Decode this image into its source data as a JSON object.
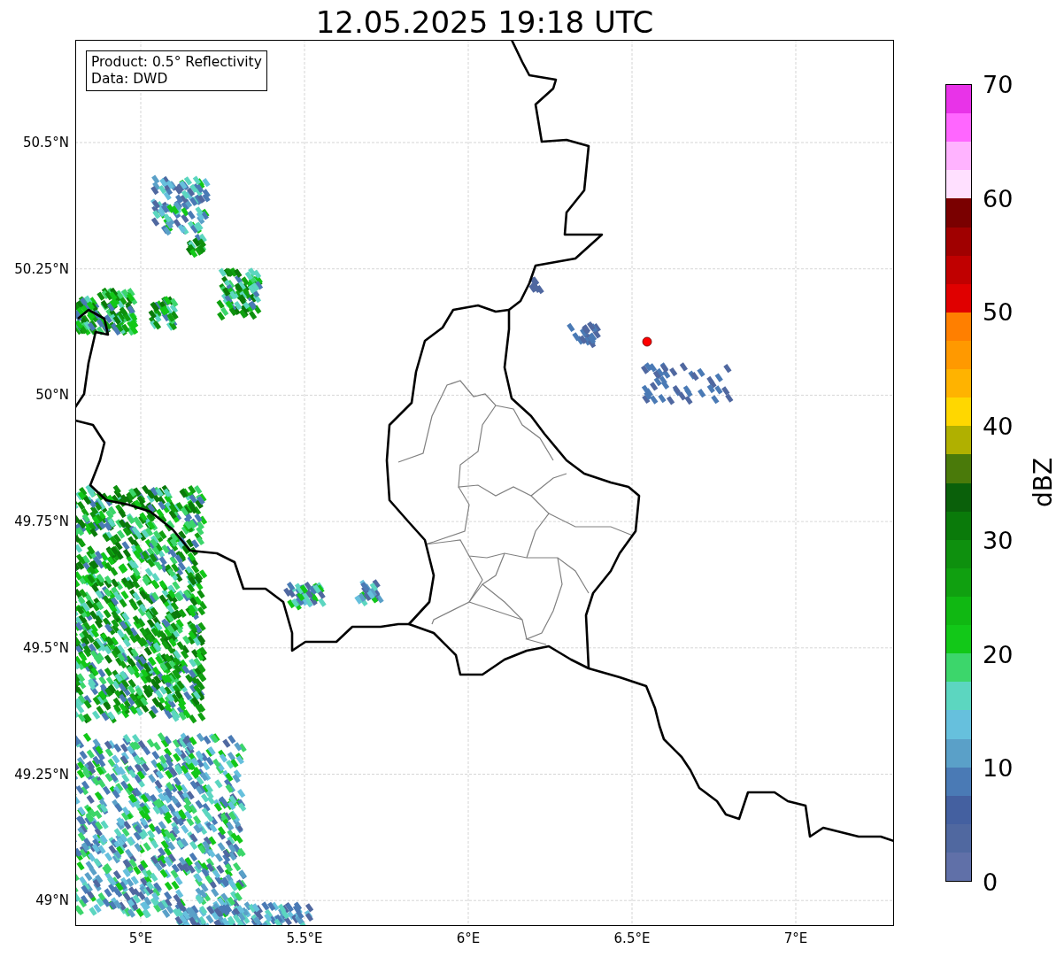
{
  "title": "12.05.2025 19:18 UTC",
  "legend": {
    "lines": [
      "Product: 0.5° Reflectivity",
      "Data: DWD"
    ]
  },
  "y_ticks": [
    "50.5°N",
    "50.25°N",
    "50°N",
    "49.75°N",
    "49.5°N",
    "49.25°N",
    "49°N"
  ],
  "x_ticks": [
    "5°E",
    "5.5°E",
    "6°E",
    "6.5°E",
    "7°E"
  ],
  "colorbar": {
    "label": "dBZ",
    "ticks": [
      "70",
      "60",
      "50",
      "40",
      "30",
      "20",
      "10",
      "0"
    ],
    "segments": [
      {
        "color": "#e833e8"
      },
      {
        "color": "#ff66ff"
      },
      {
        "color": "#ffb3ff"
      },
      {
        "color": "#ffe0ff"
      },
      {
        "color": "#7a0000"
      },
      {
        "color": "#a00000"
      },
      {
        "color": "#c00000"
      },
      {
        "color": "#e00000"
      },
      {
        "color": "#ff7f00"
      },
      {
        "color": "#ff9900"
      },
      {
        "color": "#ffb300"
      },
      {
        "color": "#ffd700"
      },
      {
        "color": "#b0b000"
      },
      {
        "color": "#4a7a0a"
      },
      {
        "color": "#0a600a"
      },
      {
        "color": "#0a7a0a"
      },
      {
        "color": "#0e900e"
      },
      {
        "color": "#10a010"
      },
      {
        "color": "#10b812"
      },
      {
        "color": "#12c818"
      },
      {
        "color": "#3cd66b"
      },
      {
        "color": "#5cd6c0"
      },
      {
        "color": "#66c0dd"
      },
      {
        "color": "#5aa0c8"
      },
      {
        "color": "#4a7ab5"
      },
      {
        "color": "#4460a0"
      },
      {
        "color": "#5068a0"
      },
      {
        "color": "#6070a8"
      }
    ]
  }
}
